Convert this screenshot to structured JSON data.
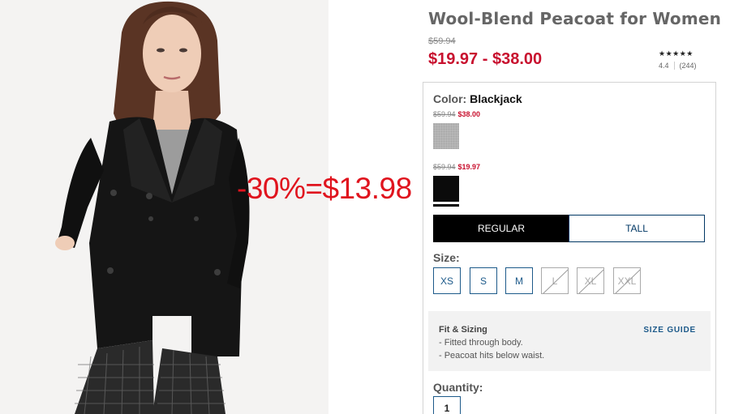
{
  "product": {
    "title": "Wool-Blend Peacoat for Women",
    "original_price": "$59.94",
    "price_range": "$19.97 - $38.00"
  },
  "rating": {
    "stars": "★★★★★",
    "score": "4.4",
    "count": "(244)"
  },
  "overlay": {
    "text": "-30%=$13.98",
    "color": "#e0141e"
  },
  "color": {
    "label": "Color:",
    "selected": "Blackjack",
    "swatches": [
      {
        "name": "grey-swatch",
        "strike_price": "$59.94",
        "sale_price": "$38.00",
        "color": "#b7b7b7"
      },
      {
        "name": "black-swatch",
        "strike_price": "$59.94",
        "sale_price": "$19.97",
        "color": "#0b0b0b",
        "selected": true
      }
    ]
  },
  "fit": {
    "options": [
      "REGULAR",
      "TALL"
    ],
    "selected": "REGULAR"
  },
  "size": {
    "label": "Size:",
    "options": [
      {
        "label": "XS",
        "available": true
      },
      {
        "label": "S",
        "available": true
      },
      {
        "label": "M",
        "available": true
      },
      {
        "label": "L",
        "available": false
      },
      {
        "label": "XL",
        "available": false
      },
      {
        "label": "XXL",
        "available": false
      }
    ]
  },
  "fit_sizing": {
    "title": "Fit & Sizing",
    "lines": [
      "- Fitted through body.",
      "- Peacoat hits below waist."
    ],
    "size_guide": "SIZE GUIDE"
  },
  "quantity": {
    "label": "Quantity:",
    "value": "1"
  },
  "colors": {
    "sale_red": "#c8102e",
    "link_blue": "#1d5a8a",
    "fit_selected_bg": "#000000"
  }
}
